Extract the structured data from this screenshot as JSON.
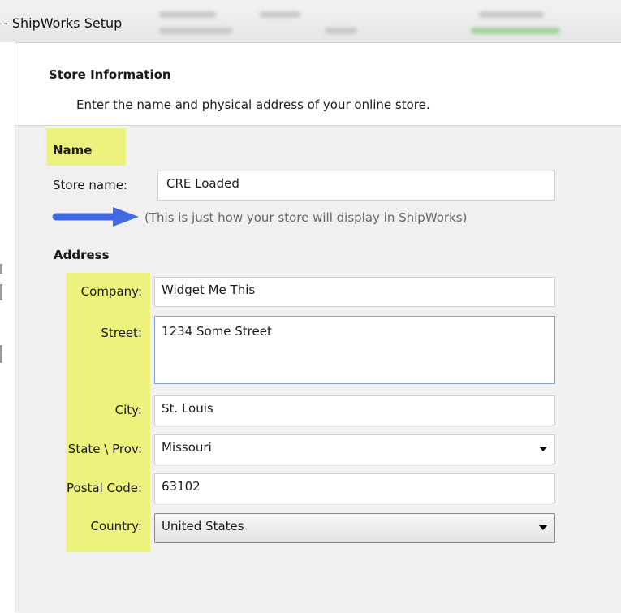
{
  "window": {
    "title": "- ShipWorks Setup"
  },
  "header": {
    "title": "Store Information",
    "subtitle": "Enter the name and physical address of your online store."
  },
  "name_section": {
    "heading": "Name",
    "store_name_label": "Store name:",
    "store_name_value": "CRE Loaded",
    "hint": "(This is just how your store will display in ShipWorks)"
  },
  "address_section": {
    "heading": "Address",
    "company_label": "Company:",
    "company_value": "Widget Me This",
    "street_label": "Street:",
    "street_value": "1234 Some Street",
    "city_label": "City:",
    "city_value": "St. Louis",
    "state_label": "State \\ Prov:",
    "state_value": "Missouri",
    "postal_label": "Postal Code:",
    "postal_value": "63102",
    "country_label": "Country:",
    "country_value": "United States"
  },
  "colors": {
    "highlight": "#ecf27c",
    "arrow": "#4169e1"
  },
  "icons": {
    "annotation": "arrow-right-icon",
    "dropdown": "chevron-down-icon"
  }
}
